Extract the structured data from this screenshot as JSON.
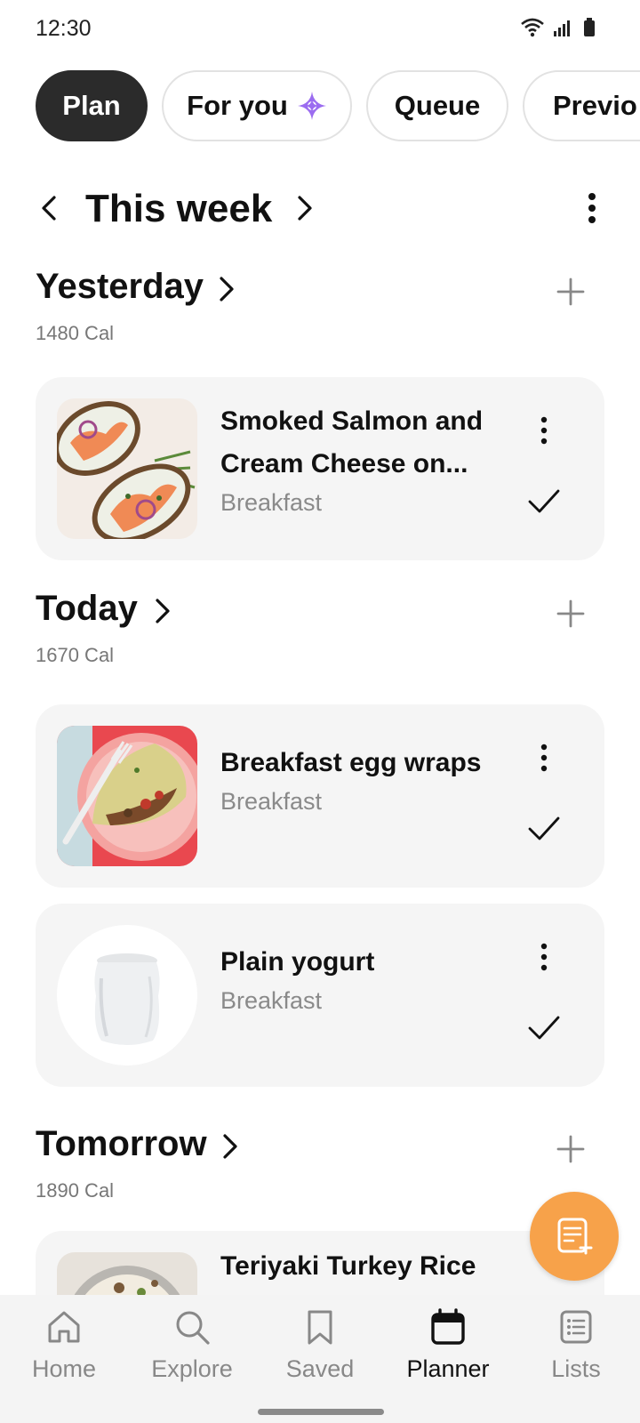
{
  "status_bar": {
    "time": "12:30"
  },
  "chips": [
    {
      "label": "Plan",
      "active": true
    },
    {
      "label": "For you",
      "icon": "sparkle-icon"
    },
    {
      "label": "Queue"
    },
    {
      "label": "Previo"
    }
  ],
  "week": {
    "title": "This week"
  },
  "days": [
    {
      "title": "Yesterday",
      "calories": "1480 Cal"
    },
    {
      "title": "Today",
      "calories": "1670 Cal"
    },
    {
      "title": "Tomorrow",
      "calories": "1890 Cal"
    }
  ],
  "meals": {
    "salmon": {
      "title": "Smoked Salmon and Cream Cheese on...",
      "type": "Breakfast"
    },
    "egg_wraps": {
      "title": "Breakfast egg wraps",
      "type": "Breakfast"
    },
    "yogurt": {
      "title": "Plain yogurt",
      "type": "Breakfast"
    },
    "teriyaki": {
      "title": "Teriyaki Turkey Rice"
    }
  },
  "bottom_nav": [
    {
      "label": "Home",
      "icon": "home-icon"
    },
    {
      "label": "Explore",
      "icon": "search-icon"
    },
    {
      "label": "Saved",
      "icon": "bookmark-icon"
    },
    {
      "label": "Planner",
      "icon": "calendar-icon",
      "active": true
    },
    {
      "label": "Lists",
      "icon": "list-icon"
    }
  ],
  "colors": {
    "accent_fab": "#f7a24a",
    "active_chip": "#2b2b2b",
    "sparkle": "#9b6cf0"
  }
}
